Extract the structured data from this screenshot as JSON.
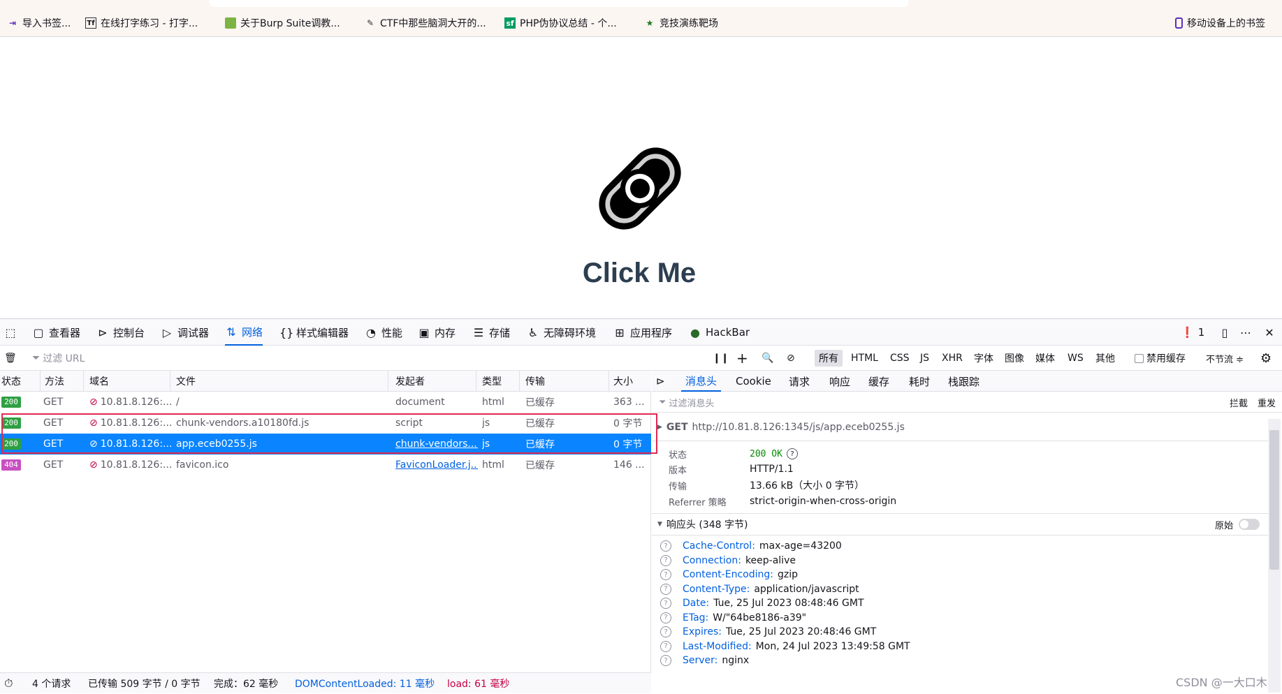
{
  "bookmarks": [
    {
      "label": "导入书签...",
      "icon": "import-icon"
    },
    {
      "label": "在线打字练习 - 打字...",
      "icon": "typing-favicon"
    },
    {
      "label": "关于Burp Suite调教...",
      "icon": "cube-favicon"
    },
    {
      "label": "CTF中那些脑洞大开的...",
      "icon": "pen-favicon"
    },
    {
      "label": "PHP伪协议总结 - 个...",
      "icon": "sf-favicon"
    },
    {
      "label": "竞技演练靶场",
      "icon": "star-favicon"
    },
    {
      "label": "移动设备上的书签",
      "icon": "mobile-icon"
    }
  ],
  "page": {
    "title": "Click Me"
  },
  "devtools": {
    "tabs": [
      {
        "label": "",
        "icon": "pick-element-icon"
      },
      {
        "label": "查看器",
        "icon": "inspector-icon"
      },
      {
        "label": "控制台",
        "icon": "console-icon"
      },
      {
        "label": "调试器",
        "icon": "debugger-icon"
      },
      {
        "label": "网络",
        "icon": "network-icon",
        "active": true
      },
      {
        "label": "样式编辑器",
        "icon": "style-editor-icon"
      },
      {
        "label": "性能",
        "icon": "performance-icon"
      },
      {
        "label": "内存",
        "icon": "memory-icon"
      },
      {
        "label": "存储",
        "icon": "storage-icon"
      },
      {
        "label": "无障碍环境",
        "icon": "accessibility-icon"
      },
      {
        "label": "应用程序",
        "icon": "application-icon"
      },
      {
        "label": "HackBar",
        "icon": "hackbar-icon"
      }
    ],
    "error_count": "1",
    "filter_placeholder": "过滤 URL",
    "type_filters": [
      "所有",
      "HTML",
      "CSS",
      "JS",
      "XHR",
      "字体",
      "图像",
      "媒体",
      "WS",
      "其他"
    ],
    "disable_cache": "禁用缓存",
    "throttle": "不节流 ≑",
    "columns": [
      "状态",
      "方法",
      "域名",
      "文件",
      "发起者",
      "类型",
      "传输",
      "大小"
    ],
    "requests": [
      {
        "status": "200",
        "status_color": "#2ea043",
        "method": "GET",
        "domain": "10.81.8.126:...",
        "file": "/",
        "initiator": "document",
        "initiator_link": false,
        "type": "html",
        "transfer": "已缓存",
        "size": "363 ..."
      },
      {
        "status": "200",
        "status_color": "#2ea043",
        "method": "GET",
        "domain": "10.81.8.126:...",
        "file": "chunk-vendors.a10180fd.js",
        "initiator": "script",
        "initiator_link": false,
        "type": "js",
        "transfer": "已缓存",
        "size": "0 字节"
      },
      {
        "status": "200",
        "status_color": "#2ea043",
        "method": "GET",
        "domain": "10.81.8.126:...",
        "file": "app.eceb0255.js",
        "initiator": "chunk-vendors....",
        "initiator_link": true,
        "type": "js",
        "transfer": "已缓存",
        "size": "0 字节",
        "selected": true
      },
      {
        "status": "404",
        "status_color": "#c850c0",
        "method": "GET",
        "domain": "10.81.8.126:...",
        "file": "favicon.ico",
        "initiator": "FaviconLoader.j...",
        "initiator_link": true,
        "type": "html",
        "transfer": "已缓存",
        "size": "146 ..."
      }
    ],
    "status_bar": {
      "requests": "4 个请求",
      "transferred": "已传输 509 字节 / 0 字节",
      "finish": "完成：62 毫秒",
      "dom_loaded": "DOMContentLoaded: 11 毫秒",
      "load": "load: 61 毫秒"
    },
    "detail": {
      "tabs": [
        "消息头",
        "Cookie",
        "请求",
        "响应",
        "缓存",
        "耗时",
        "栈跟踪"
      ],
      "filter_placeholder": "过滤消息头",
      "block": "拦截",
      "resend": "重发",
      "request_line": {
        "method": "GET",
        "url": "http://10.81.8.126:1345/js/app.eceb0255.js"
      },
      "summary": [
        {
          "key": "状态",
          "value": "200 OK"
        },
        {
          "key": "版本",
          "value": "HTTP/1.1"
        },
        {
          "key": "传输",
          "value": "13.66 kB（大小 0 字节）"
        },
        {
          "key": "Referrer 策略",
          "value": "strict-origin-when-cross-origin"
        }
      ],
      "response_headers_title": "响应头 (348 字节)",
      "raw_label": "原始",
      "headers": [
        {
          "name": "Cache-Control:",
          "value": "max-age=43200"
        },
        {
          "name": "Connection:",
          "value": "keep-alive"
        },
        {
          "name": "Content-Encoding:",
          "value": "gzip"
        },
        {
          "name": "Content-Type:",
          "value": "application/javascript"
        },
        {
          "name": "Date:",
          "value": "Tue, 25 Jul 2023 08:48:46 GMT"
        },
        {
          "name": "ETag:",
          "value": "W/\"64be8186-a39\""
        },
        {
          "name": "Expires:",
          "value": "Tue, 25 Jul 2023 20:48:46 GMT"
        },
        {
          "name": "Last-Modified:",
          "value": "Mon, 24 Jul 2023 13:49:58 GMT"
        },
        {
          "name": "Server:",
          "value": "nginx"
        }
      ]
    }
  },
  "watermark": "CSDN @一大口木"
}
